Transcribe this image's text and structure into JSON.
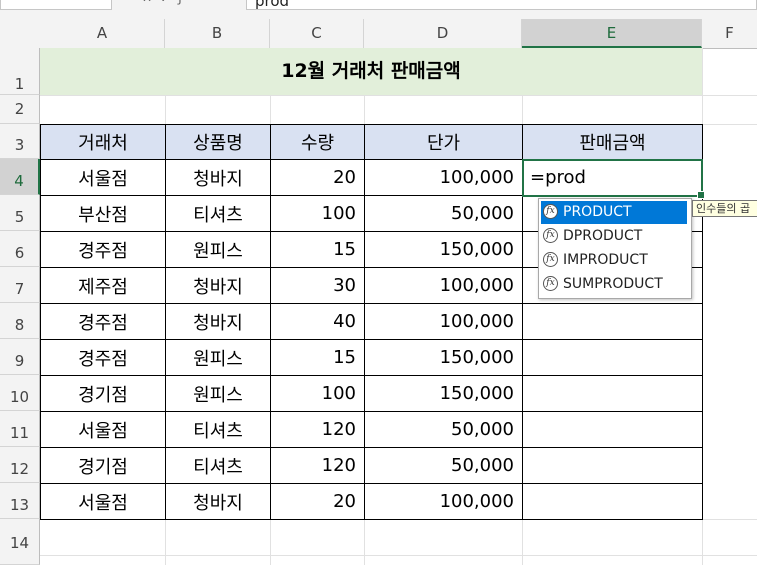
{
  "formula_bar": {
    "formula_text": "prod",
    "icons": [
      "cancel-icon",
      "enter-icon",
      "function-icon"
    ]
  },
  "columns": [
    "A",
    "B",
    "C",
    "D",
    "E",
    "F"
  ],
  "rows": [
    "1",
    "2",
    "3",
    "4",
    "5",
    "6",
    "7",
    "8",
    "9",
    "10",
    "11",
    "12",
    "13",
    "14"
  ],
  "active_cell": "E4",
  "sheet_title": "12월 거래처 판매금액",
  "table": {
    "headers": [
      "거래처",
      "상품명",
      "수량",
      "단가",
      "판매금액"
    ],
    "rows": [
      {
        "store": "서울점",
        "product": "청바지",
        "qty": "20",
        "price": "100,000",
        "amount": "=prod"
      },
      {
        "store": "부산점",
        "product": "티셔츠",
        "qty": "100",
        "price": "50,000",
        "amount": ""
      },
      {
        "store": "경주점",
        "product": "원피스",
        "qty": "15",
        "price": "150,000",
        "amount": ""
      },
      {
        "store": "제주점",
        "product": "청바지",
        "qty": "30",
        "price": "100,000",
        "amount": ""
      },
      {
        "store": "경주점",
        "product": "청바지",
        "qty": "40",
        "price": "100,000",
        "amount": ""
      },
      {
        "store": "경주점",
        "product": "원피스",
        "qty": "15",
        "price": "150,000",
        "amount": ""
      },
      {
        "store": "경기점",
        "product": "원피스",
        "qty": "100",
        "price": "150,000",
        "amount": ""
      },
      {
        "store": "서울점",
        "product": "티셔츠",
        "qty": "120",
        "price": "50,000",
        "amount": ""
      },
      {
        "store": "경기점",
        "product": "티셔츠",
        "qty": "120",
        "price": "50,000",
        "amount": ""
      },
      {
        "store": "서울점",
        "product": "청바지",
        "qty": "20",
        "price": "100,000",
        "amount": ""
      }
    ]
  },
  "autocomplete": {
    "icon_text": "fx",
    "items": [
      "PRODUCT",
      "DPRODUCT",
      "IMPRODUCT",
      "SUMPRODUCT"
    ],
    "selected_index": 0
  },
  "tooltip": "인수들의 곱",
  "colors": {
    "title_fill": "#e2efda",
    "header_fill": "#d9e1f2",
    "selection_green": "#217346",
    "autocomplete_highlight": "#0078d7"
  }
}
